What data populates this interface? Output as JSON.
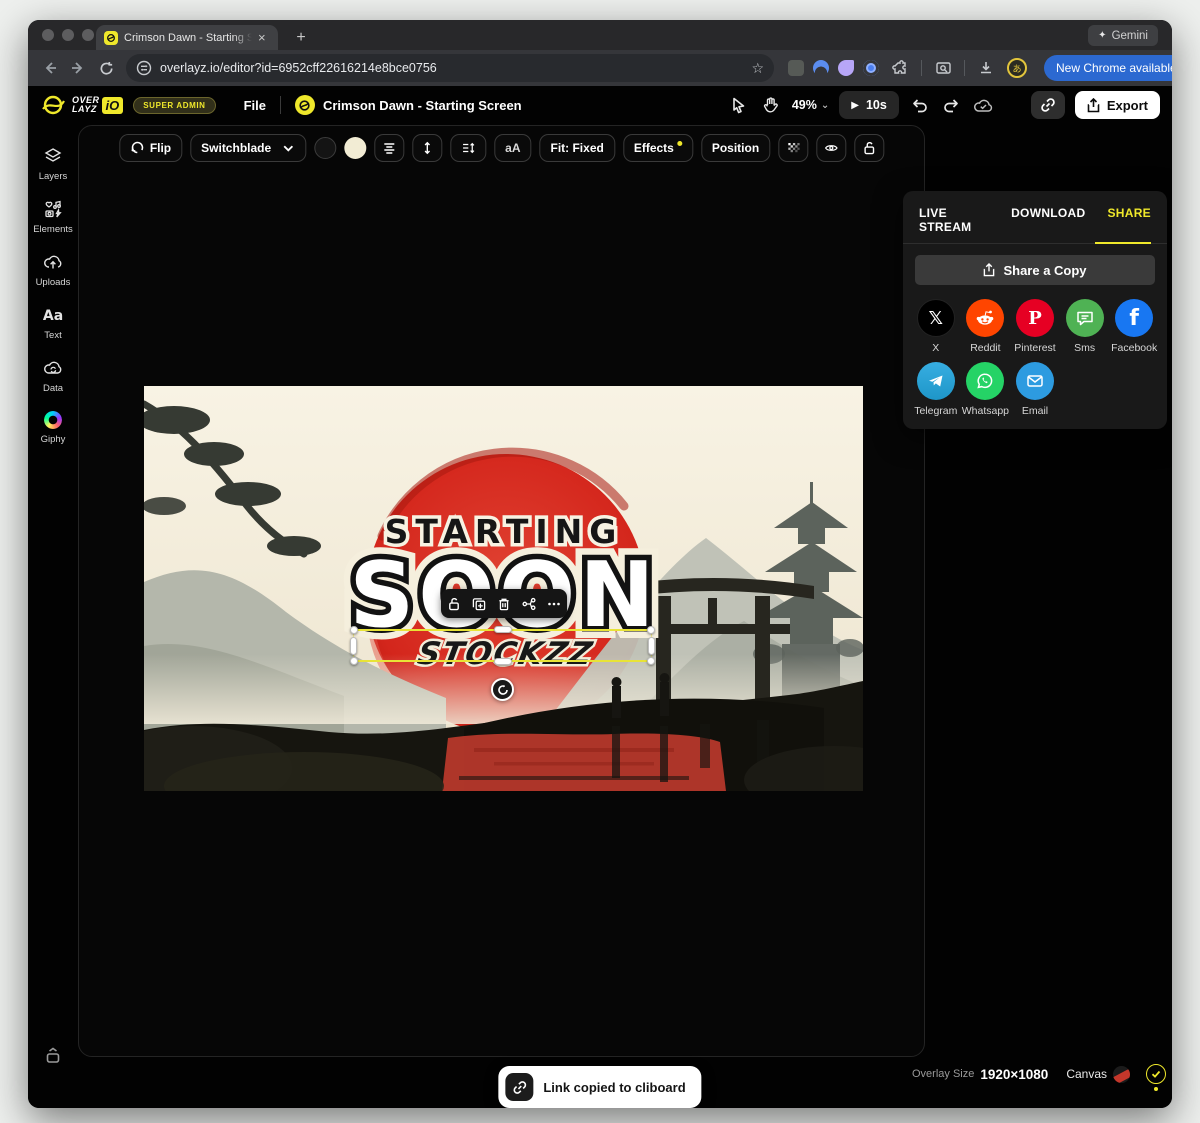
{
  "browser": {
    "tab_title": "Crimson Dawn - Starting Scre",
    "tab_close": "×",
    "new_tab": "+",
    "gemini_spark": "✦",
    "gemini_label": "Gemini",
    "url": "overlayz.io/editor?id=6952cff22616214e8bce0756",
    "bookmark_star": "☆",
    "update_button": "New Chrome available",
    "kebab": "⋮"
  },
  "header": {
    "brand_line1": "OVER",
    "brand_line2": "LAYZ",
    "brand_suffix": "iO",
    "admin_badge": "SUPER ADMIN",
    "file_menu": "File",
    "doc_title": "Crimson Dawn - Starting Screen",
    "zoom_level": "49%",
    "zoom_chevron": "⌄",
    "play_glyph": "▶",
    "duration_button": "10s",
    "export_label": "Export"
  },
  "sidebar": {
    "items": [
      {
        "label": "Layers"
      },
      {
        "label": "Elements"
      },
      {
        "label": "Uploads"
      },
      {
        "label": "Text"
      },
      {
        "label": "Data"
      },
      {
        "label": "Giphy"
      }
    ]
  },
  "toolbar": {
    "flip_label": "Flip",
    "font_name": "Switchblade",
    "case_label": "aA",
    "fit_label": "Fit: Fixed",
    "effects_label": "Effects",
    "position_label": "Position",
    "stroke_swatch_color": "#141414",
    "fill_swatch_color": "#f2ecd4"
  },
  "canvas": {
    "text_starting": "STARTING",
    "text_soon": "SOON",
    "text_brand": "STOCKZZ",
    "sun_color": "#d7261d",
    "sky_color": "#f2ebd8",
    "ink_color": "#16150f",
    "reflection_color": "#bf3a2c"
  },
  "share_panel": {
    "tabs": [
      {
        "label": "LIVE STREAM"
      },
      {
        "label": "DOWNLOAD"
      },
      {
        "label": "SHARE"
      }
    ],
    "active_tab": "SHARE",
    "share_copy_label": "Share a Copy",
    "targets": [
      {
        "label": "X",
        "color": "#000000"
      },
      {
        "label": "Reddit",
        "color": "#ff4500"
      },
      {
        "label": "Pinterest",
        "color": "#e60023"
      },
      {
        "label": "Sms",
        "color": "#4fb254"
      },
      {
        "label": "Facebook",
        "color": "#1877f2"
      },
      {
        "label": "Telegram",
        "color": "#2ca5e0"
      },
      {
        "label": "Whatsapp",
        "color": "#25d366"
      },
      {
        "label": "Email",
        "color": "#2d9be0"
      }
    ]
  },
  "toast": {
    "message": "Link copied to cliboard"
  },
  "status_bar": {
    "overlay_size_label": "Overlay Size",
    "overlay_size_value": "1920×1080",
    "canvas_label": "Canvas"
  },
  "colors": {
    "accent_yellow": "#efe82b",
    "chrome_update_blue": "#2c69d1",
    "selection_yellow": "#e8e337"
  }
}
